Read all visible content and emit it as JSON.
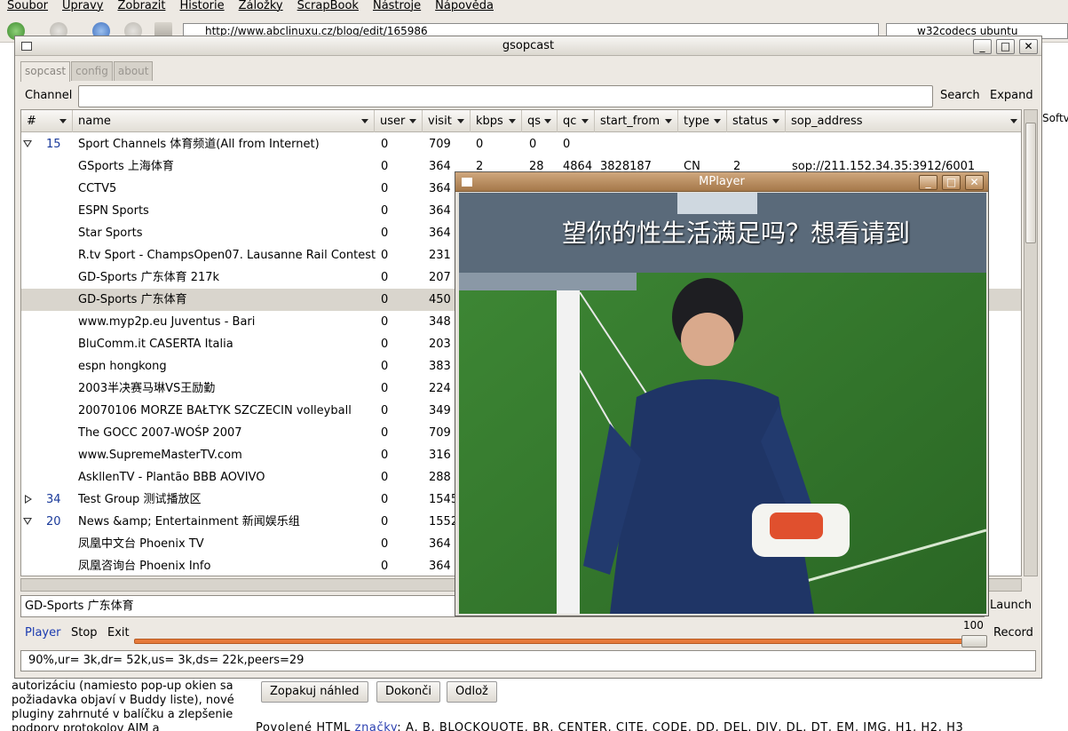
{
  "browser": {
    "menu": [
      "Soubor",
      "Úpravy",
      "Zobrazit",
      "Historie",
      "Záložky",
      "ScrapBook",
      "Nástroje",
      "Nápověda"
    ],
    "url": "http://www.abclinuxu.cz/blog/edit/165986",
    "search_query": "w32codecs ubuntu",
    "right_side_text": "Softv",
    "bottom_left_text": "autorizáciu (namiesto pop-up okien sa požiadavka objaví v Buddy liste), nové pluginy zahrnuté v balíčku a zlepšenie podpory protokolov AIM a",
    "buttons": {
      "preview": "Zopakuj náhled",
      "finish": "Dokonči",
      "store": "Odlož"
    },
    "allowed_label": "Povolené HTML",
    "allowed_link": "značky",
    "allowed_tags": ": A, B, BLOCKQUOTE, BR, CENTER, CITE, CODE, DD, DEL, DIV, DL, DT, EM, IMG, H1, H2, H3"
  },
  "gsopcast": {
    "title": "gsopcast",
    "tabs": [
      "sopcast",
      "config",
      "about"
    ],
    "channel_label": "Channel",
    "channel_value": "",
    "search_label": "Search",
    "expand_label": "Expand",
    "columns": [
      "#",
      "name",
      "user",
      "visit",
      "kbps",
      "qs",
      "qc",
      "start_from",
      "type",
      "status",
      "sop_address"
    ],
    "rows": [
      {
        "expander": "open",
        "num": "15",
        "name": "Sport Channels  体育频道(All from Internet)",
        "user": "0",
        "visit": "709",
        "kbps": "0",
        "qs": "0",
        "qc": "0",
        "start_from": "",
        "type": "",
        "status": "",
        "sop_address": ""
      },
      {
        "expander": "",
        "num": "",
        "name": "GSports 上海体育",
        "user": "0",
        "visit": "364",
        "kbps": "2",
        "qs": "28",
        "qc": "4864",
        "start_from": "3828187",
        "type": "CN",
        "status": "2",
        "sop_address": "sop://211.152.34.35:3912/6001"
      },
      {
        "expander": "",
        "num": "",
        "name": "CCTV5",
        "user": "0",
        "visit": "364"
      },
      {
        "expander": "",
        "num": "",
        "name": "ESPN Sports",
        "user": "0",
        "visit": "364"
      },
      {
        "expander": "",
        "num": "",
        "name": "Star Sports",
        "user": "0",
        "visit": "364"
      },
      {
        "expander": "",
        "num": "",
        "name": "R.tv Sport - ChampsOpen07. Lausanne Rail Contest",
        "user": "0",
        "visit": "231"
      },
      {
        "expander": "",
        "num": "",
        "name": "GD-Sports 广东体育 217k",
        "user": "0",
        "visit": "207"
      },
      {
        "expander": "",
        "num": "",
        "name": "GD-Sports 广东体育",
        "user": "0",
        "visit": "450",
        "selected": true
      },
      {
        "expander": "",
        "num": "",
        "name": "www.myp2p.eu Juventus - Bari",
        "user": "0",
        "visit": "348"
      },
      {
        "expander": "",
        "num": "",
        "name": "BluComm.it CASERTA Italia",
        "user": "0",
        "visit": "203"
      },
      {
        "expander": "",
        "num": "",
        "name": "espn hongkong",
        "user": "0",
        "visit": "383"
      },
      {
        "expander": "",
        "num": "",
        "name": "2003半决赛马琳VS王励勤",
        "user": "0",
        "visit": "224"
      },
      {
        "expander": "",
        "num": "",
        "name": "20070106 MORZE BAŁTYK SZCZECIN volleyball",
        "user": "0",
        "visit": "349"
      },
      {
        "expander": "",
        "num": "",
        "name": "The GOCC 2007-WOŚP 2007",
        "user": "0",
        "visit": "709"
      },
      {
        "expander": "",
        "num": "",
        "name": "www.SupremeMasterTV.com",
        "user": "0",
        "visit": "316"
      },
      {
        "expander": "",
        "num": "",
        "name": "AskllenTV - Plantão BBB AOVIVO",
        "user": "0",
        "visit": "288"
      },
      {
        "expander": "closed",
        "num": "34",
        "name": "Test Group 测试播放区",
        "user": "0",
        "visit": "1545"
      },
      {
        "expander": "open",
        "num": "20",
        "name": "News &amp; Entertainment  新闻娱乐组",
        "user": "0",
        "visit": "1552"
      },
      {
        "expander": "",
        "num": "",
        "name": "凤凰中文台 Phoenix TV",
        "user": "0",
        "visit": "364"
      },
      {
        "expander": "",
        "num": "",
        "name": "凤凰咨询台 Phoenix Info",
        "user": "0",
        "visit": "364"
      }
    ],
    "selected_channel": "GD-Sports 广东体育",
    "launch_label": "Launch",
    "player_label": "Player",
    "stop_label": "Stop",
    "exit_label": "Exit",
    "volume": 100,
    "volume_label": "100",
    "record_label": "Record",
    "status_text": "90%,ur= 3k,dr= 52k,us= 3k,ds= 22k,peers=29"
  },
  "mplayer": {
    "title": "MPlayer",
    "video_caption": "望你的性生活满足吗？想看请到"
  },
  "colors": {
    "accent_blue": "#1a3ab0",
    "slider_orange": "#e67a3a",
    "mplayer_title": "#a5784a"
  }
}
